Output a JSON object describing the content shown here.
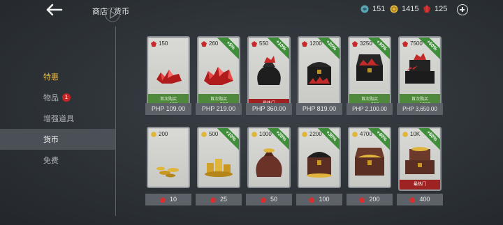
{
  "header": {
    "breadcrumb": "商店 / 货币",
    "currencies": [
      {
        "icon": "blue-token-icon",
        "value": "151"
      },
      {
        "icon": "gold-coin-icon",
        "value": "1415"
      },
      {
        "icon": "red-gem-icon",
        "value": "125"
      }
    ]
  },
  "sidebar": {
    "items": [
      {
        "label": "特惠"
      },
      {
        "label": "物品",
        "badge": "1"
      },
      {
        "label": "增强道具"
      },
      {
        "label": "货币"
      },
      {
        "label": "免费"
      }
    ]
  },
  "gems": [
    {
      "amount": "150",
      "first_buy": "首次购买",
      "bonus": "150",
      "price": "PHP 109.00"
    },
    {
      "amount": "260",
      "ribbon": "+5%",
      "first_buy": "首次购买",
      "bonus": "260",
      "price": "PHP 219.00"
    },
    {
      "amount": "550",
      "ribbon": "+10%",
      "hot": "最热门",
      "price": "PHP 360.00"
    },
    {
      "amount": "1200",
      "ribbon": "+20%",
      "price": "PHP 819.00"
    },
    {
      "amount": "3250",
      "ribbon": "+30%",
      "first_buy": "首次购买",
      "bonus": "650",
      "price": "PHP 2,100.00"
    },
    {
      "amount": "7500",
      "ribbon": "+50%",
      "first_buy": "首次购买",
      "bonus": "1500",
      "price": "PHP 3,650.00"
    }
  ],
  "coins": [
    {
      "amount": "200",
      "price": "10"
    },
    {
      "amount": "500",
      "ribbon": "+10%",
      "price": "25"
    },
    {
      "amount": "1000",
      "ribbon": "+20%",
      "price": "50"
    },
    {
      "amount": "2200",
      "ribbon": "+30%",
      "price": "100"
    },
    {
      "amount": "4700",
      "ribbon": "+40%",
      "price": "200"
    },
    {
      "amount": "10K",
      "ribbon": "+50%",
      "hot": "最热门",
      "price": "400"
    }
  ],
  "colors": {
    "accent_gold": "#e2b448",
    "ribbon_green": "#3f8f3a",
    "hot_red": "#9e2222",
    "badge_red": "#c92424"
  }
}
